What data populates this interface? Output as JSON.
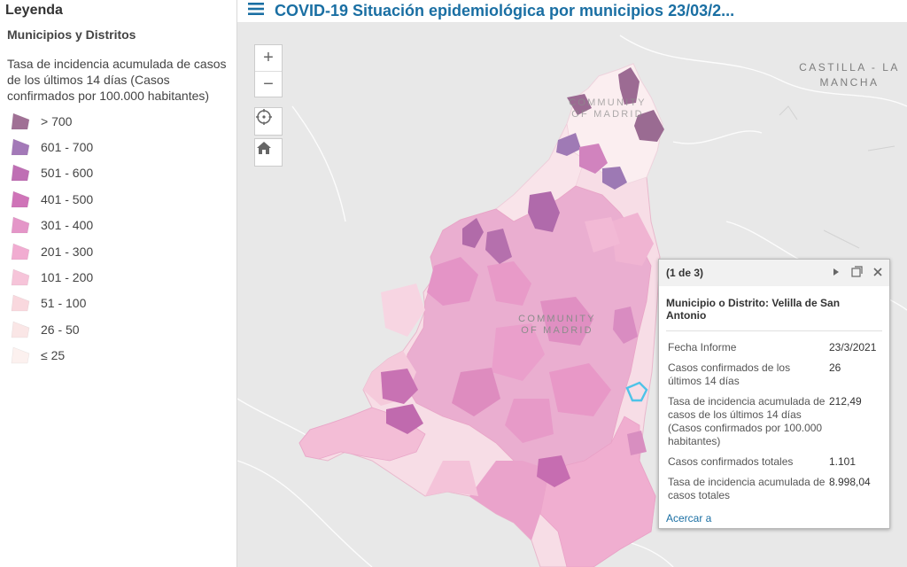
{
  "app": {
    "title": "COVID-19 Situación epidemiológica por municipios 23/03/2..."
  },
  "legend": {
    "title": "Leyenda",
    "layer_name": "Municipios y Distritos",
    "field_name": "Tasa de incidencia acumulada de casos de los últimos 14 días (Casos confirmados por 100.000 habitantes)",
    "classes": [
      {
        "label": "> 700",
        "color": "#a07095"
      },
      {
        "label": "601 - 700",
        "color": "#a379b8"
      },
      {
        "label": "501 - 600",
        "color": "#bf6fb4"
      },
      {
        "label": "401 - 500",
        "color": "#cf74b8"
      },
      {
        "label": "301 - 400",
        "color": "#e496c8"
      },
      {
        "label": "201 - 300",
        "color": "#f1acd1"
      },
      {
        "label": "101 - 200",
        "color": "#f6c4d9"
      },
      {
        "label": "51 - 100",
        "color": "#f9d8de"
      },
      {
        "label": "26 - 50",
        "color": "#fae6e6"
      },
      {
        "label": "≤ 25",
        "color": "#fcf1ef"
      }
    ]
  },
  "map": {
    "controls": {
      "zoom_in": "+",
      "zoom_out": "−"
    },
    "labels": {
      "castilla": "CASTILLA - LA MANCHA",
      "community_top": "COMMUNITY OF MADRID",
      "community_center": "COMMUNITY OF MADRID"
    },
    "colors": {
      "background": "#e8e8e8",
      "selected_outline": "#4fc3e8"
    }
  },
  "popup": {
    "counter": "(1 de 3)",
    "title": "Municipio o Distrito: Velilla de San Antonio",
    "fields": [
      {
        "key": "Fecha Informe",
        "value": "23/3/2021"
      },
      {
        "key": "Casos confirmados de los últimos 14 días",
        "value": "26"
      },
      {
        "key": "Tasa de incidencia acumulada de casos de los últimos 14 días (Casos confirmados por 100.000 habitantes)",
        "value": "212,49"
      },
      {
        "key": "Casos confirmados totales",
        "value": "1.101"
      },
      {
        "key": "Tasa de incidencia acumulada de casos totales",
        "value": "8.998,04"
      }
    ],
    "zoom_link": "Acercar a"
  }
}
